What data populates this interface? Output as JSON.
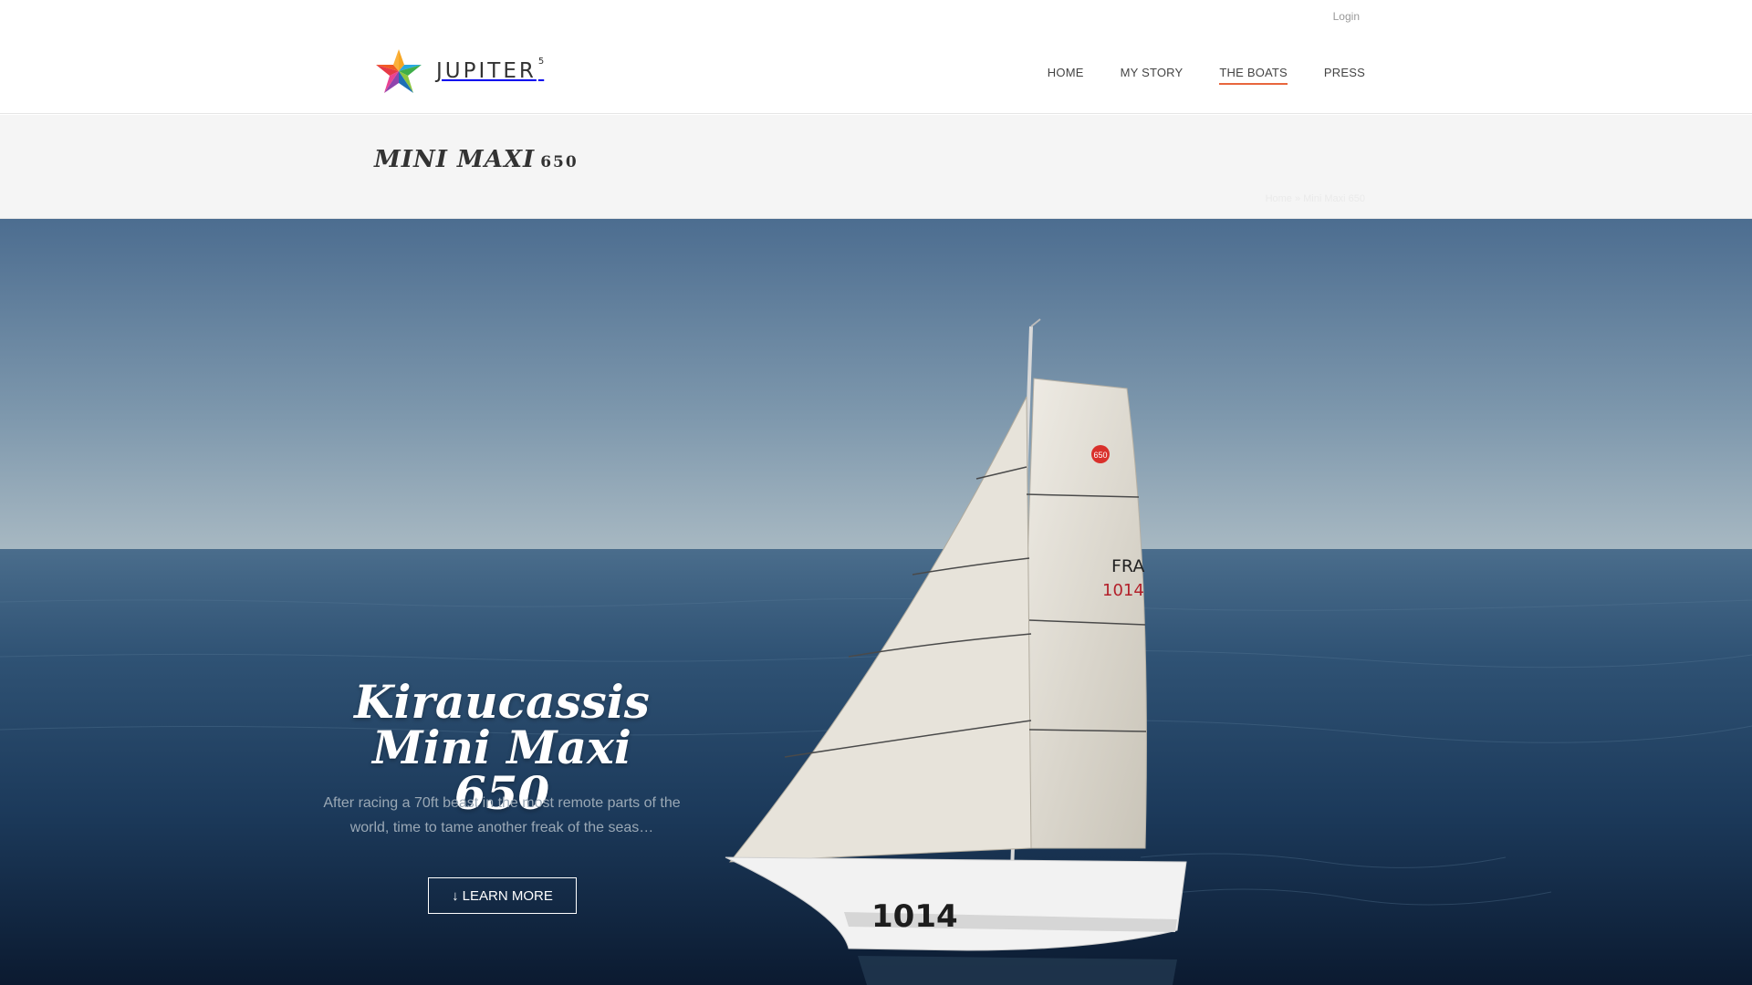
{
  "header": {
    "login": "Login",
    "logo_text": "JUPITER",
    "logo_sup": "5",
    "nav": [
      {
        "label": "HOME"
      },
      {
        "label": "MY STORY"
      },
      {
        "label": "THE BOATS",
        "active": true
      },
      {
        "label": "PRESS"
      }
    ]
  },
  "title_bar": {
    "title": "MINI MAXI",
    "title_number": "650",
    "breadcrumb": "Home » Mini Maxi 650"
  },
  "hero": {
    "heading_line1": "Kiraucassis",
    "heading_line2": "Mini Maxi 650",
    "description": "After racing a 70ft beast in the most remote parts of the world, time to tame another freak of the seas…",
    "button_icon": "arrow-down-icon",
    "button_label": "LEARN MORE",
    "sail_number": "1014",
    "sail_country": "FRA",
    "class_badge": "650"
  },
  "colors": {
    "accent": "#e8663d",
    "title_bar_bg": "#f5f5f5"
  }
}
